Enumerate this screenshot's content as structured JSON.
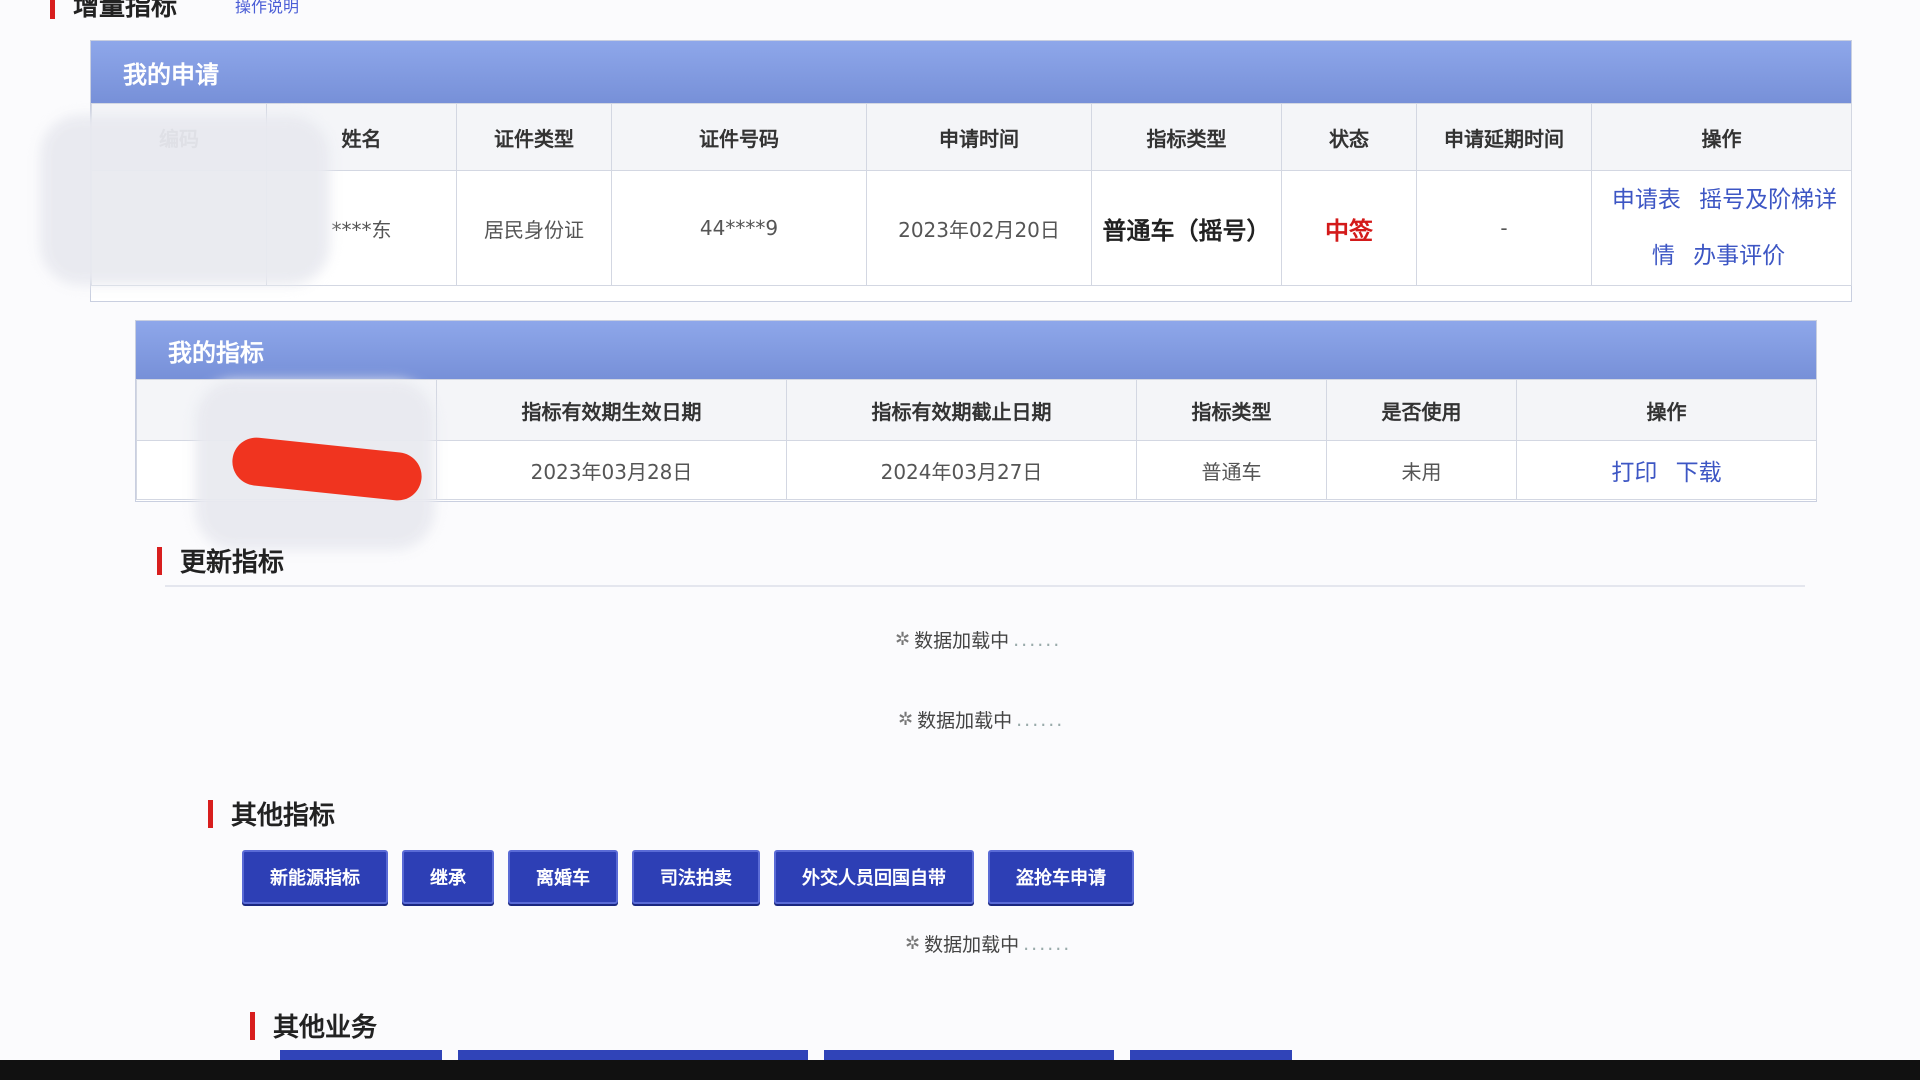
{
  "top_section": {
    "title": "增量指标",
    "link": "操作说明"
  },
  "my_application": {
    "panel_title": "我的申请",
    "columns": [
      "编码",
      "姓名",
      "证件类型",
      "证件号码",
      "申请时间",
      "指标类型",
      "状态",
      "申请延期时间",
      "操作"
    ],
    "row": {
      "code": "",
      "name": "****东",
      "id_type": "居民身份证",
      "id_number": "44****9",
      "apply_time": "2023年02月20日",
      "quota_type": "普通车（摇号）",
      "status": "中签",
      "extension_time": "-"
    },
    "actions": [
      "申请表",
      "摇号及阶梯详情",
      "办事评价"
    ],
    "status_color": "#d31a1a"
  },
  "my_quota": {
    "panel_title": "我的指标",
    "columns": [
      "",
      "指标有效期生效日期",
      "指标有效期截止日期",
      "指标类型",
      "是否使用",
      "操作"
    ],
    "row": {
      "effective_date": "2023年03月28日",
      "expiry_date": "2024年03月27日",
      "quota_type": "普通车",
      "used": "未用"
    },
    "actions": [
      "打印",
      "下载"
    ]
  },
  "update_section": {
    "title": "更新指标",
    "loading_1": "数据加载中",
    "loading_2": "数据加载中",
    "dots": "......"
  },
  "other_quota": {
    "title": "其他指标",
    "buttons": [
      "新能源指标",
      "继承",
      "离婚车",
      "司法拍卖",
      "外交人员回国自带",
      "盗抢车申请"
    ],
    "loading": "数据加载中",
    "dots": "......"
  },
  "other_business": {
    "title": "其他业务"
  },
  "colors": {
    "panel_header": "#7f9ae0",
    "button": "#2d3fb5",
    "link": "#3d56c4",
    "accent_bar": "#d81e1e"
  }
}
